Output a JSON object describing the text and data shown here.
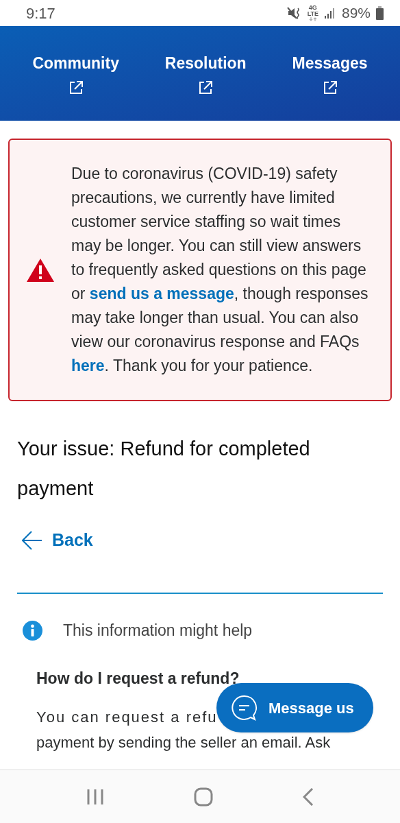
{
  "status_bar": {
    "time": "9:17",
    "network": [
      "4G",
      "LTE"
    ],
    "battery": "89%"
  },
  "nav_links": [
    {
      "label": "Community"
    },
    {
      "label": "Resolution"
    },
    {
      "label": "Messages"
    }
  ],
  "alert": {
    "segments": [
      {
        "kind": "text",
        "text": "Due to coronavirus (COVID-19) safety precautions, we currently have limited customer service staffing so wait times may be longer. You can still view answers to frequently asked questions on this page or "
      },
      {
        "kind": "link",
        "text": "send us a message"
      },
      {
        "kind": "text",
        "text": ", though responses may take longer than usual. You can also view our coronavirus response and FAQs "
      },
      {
        "kind": "link",
        "text": "here"
      },
      {
        "kind": "text",
        "text": ". Thank you for your patience."
      }
    ]
  },
  "issue_title": "Your issue: Refund for completed payment",
  "back_link": "Back",
  "info": {
    "label": "This information might help"
  },
  "article": {
    "heading": "How do I request a refund?",
    "lines": [
      "You can request a refu",
      "payment by sending the seller an email. Ask"
    ]
  },
  "chat_button": "Message us"
}
